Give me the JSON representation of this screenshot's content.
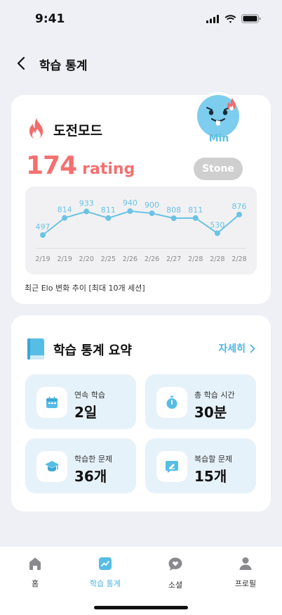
{
  "status_bar": {
    "time": "9:41"
  },
  "header": {
    "title": "학습 통계",
    "back_icon": "chevron-left-icon"
  },
  "challenge": {
    "title": "도전모드",
    "rating_value": "174",
    "rating_unit": "rating",
    "tier": "Stone",
    "mascot_name": "Min",
    "caption": "최근 Elo 변화 추이 [최대 10개 세션]",
    "colors": {
      "rating": "#f47070",
      "line": "#6cc3e4",
      "badge": "#cfcfcf"
    }
  },
  "chart_data": {
    "type": "line",
    "x": [
      "2/19",
      "2/19",
      "2/20",
      "2/25",
      "2/26",
      "2/26",
      "2/27",
      "2/28",
      "2/28",
      "2/28"
    ],
    "series": [
      {
        "values": [
          497,
          814,
          933,
          811,
          940,
          900,
          808,
          811,
          530,
          876
        ]
      }
    ],
    "data_labels": [
      "497",
      "814",
      "933",
      "811",
      "940",
      "900",
      "808",
      "811",
      "530",
      "876"
    ],
    "grid": false
  },
  "summary": {
    "title": "학습 통계 요약",
    "detail_label": "자세히",
    "tiles": [
      {
        "label": "연속 학습",
        "value": "2일",
        "icon": "calendar-icon"
      },
      {
        "label": "총 학습 시간",
        "value": "30분",
        "icon": "stopwatch-icon"
      },
      {
        "label": "학습한 문제",
        "value": "36개",
        "icon": "graduation-cap-icon"
      },
      {
        "label": "복습할 문제",
        "value": "15개",
        "icon": "edit-note-icon"
      }
    ]
  },
  "tabs": [
    {
      "label": "홈",
      "icon": "home-icon",
      "active": false
    },
    {
      "label": "학습 통계",
      "icon": "chart-icon",
      "active": true
    },
    {
      "label": "소셜",
      "icon": "chat-heart-icon",
      "active": false
    },
    {
      "label": "프로필",
      "icon": "person-icon",
      "active": false
    }
  ]
}
